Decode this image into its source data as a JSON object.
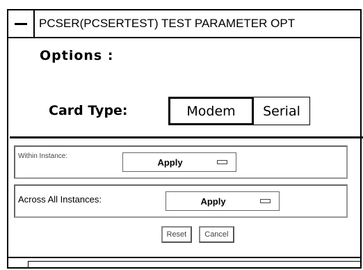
{
  "window": {
    "title": "PCSER(PCSERTEST) TEST PARAMETER OPT"
  },
  "options": {
    "heading": "Options :",
    "card_type": {
      "label": "Card Type:",
      "choices": [
        "Modem",
        "Serial"
      ],
      "selected": "Modem"
    }
  },
  "instances": {
    "within": {
      "label": "Within Instance:",
      "value": "Apply"
    },
    "across": {
      "label": "Across All Instances:",
      "value": "Apply"
    }
  },
  "buttons": {
    "reset": "Reset",
    "cancel": "Cancel"
  }
}
